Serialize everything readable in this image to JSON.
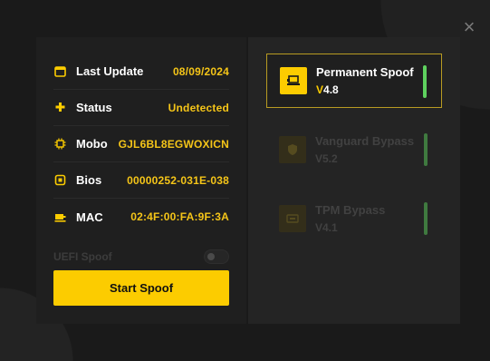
{
  "window": {
    "close_icon": "×"
  },
  "info": [
    {
      "label": "Last Update",
      "value": "08/09/2024",
      "icon": "calendar-icon"
    },
    {
      "label": "Status",
      "value": "Undetected",
      "icon": "puzzle-icon"
    },
    {
      "label": "Mobo",
      "value": "GJL6BL8EGWOXICN",
      "icon": "chip-icon"
    },
    {
      "label": "Bios",
      "value": "00000252-031E-038",
      "icon": "bios-icon"
    },
    {
      "label": "MAC",
      "value": "02:4F:00:FA:9F:3A",
      "icon": "network-icon"
    }
  ],
  "uefi": {
    "label": "UEFI Spoof",
    "enabled": false
  },
  "start_button": "Start Spoof",
  "spoofers": [
    {
      "title": "Permanent Spoof",
      "version_prefix": "V",
      "version": "4.8",
      "version_full": "V4.8",
      "active": true,
      "icon": "laptop-icon"
    },
    {
      "title": "Vanguard Bypass",
      "version_full": "V5.2",
      "active": false,
      "icon": "shield-icon"
    },
    {
      "title": "TPM Bypass",
      "version_full": "V4.1",
      "active": false,
      "icon": "tpm-icon"
    }
  ],
  "colors": {
    "accent": "#fccc00",
    "value_text": "#f5c518",
    "status_green": "#5ed15e",
    "panel_bg": "#1f1f1f",
    "page_bg": "#1a1a1a"
  }
}
